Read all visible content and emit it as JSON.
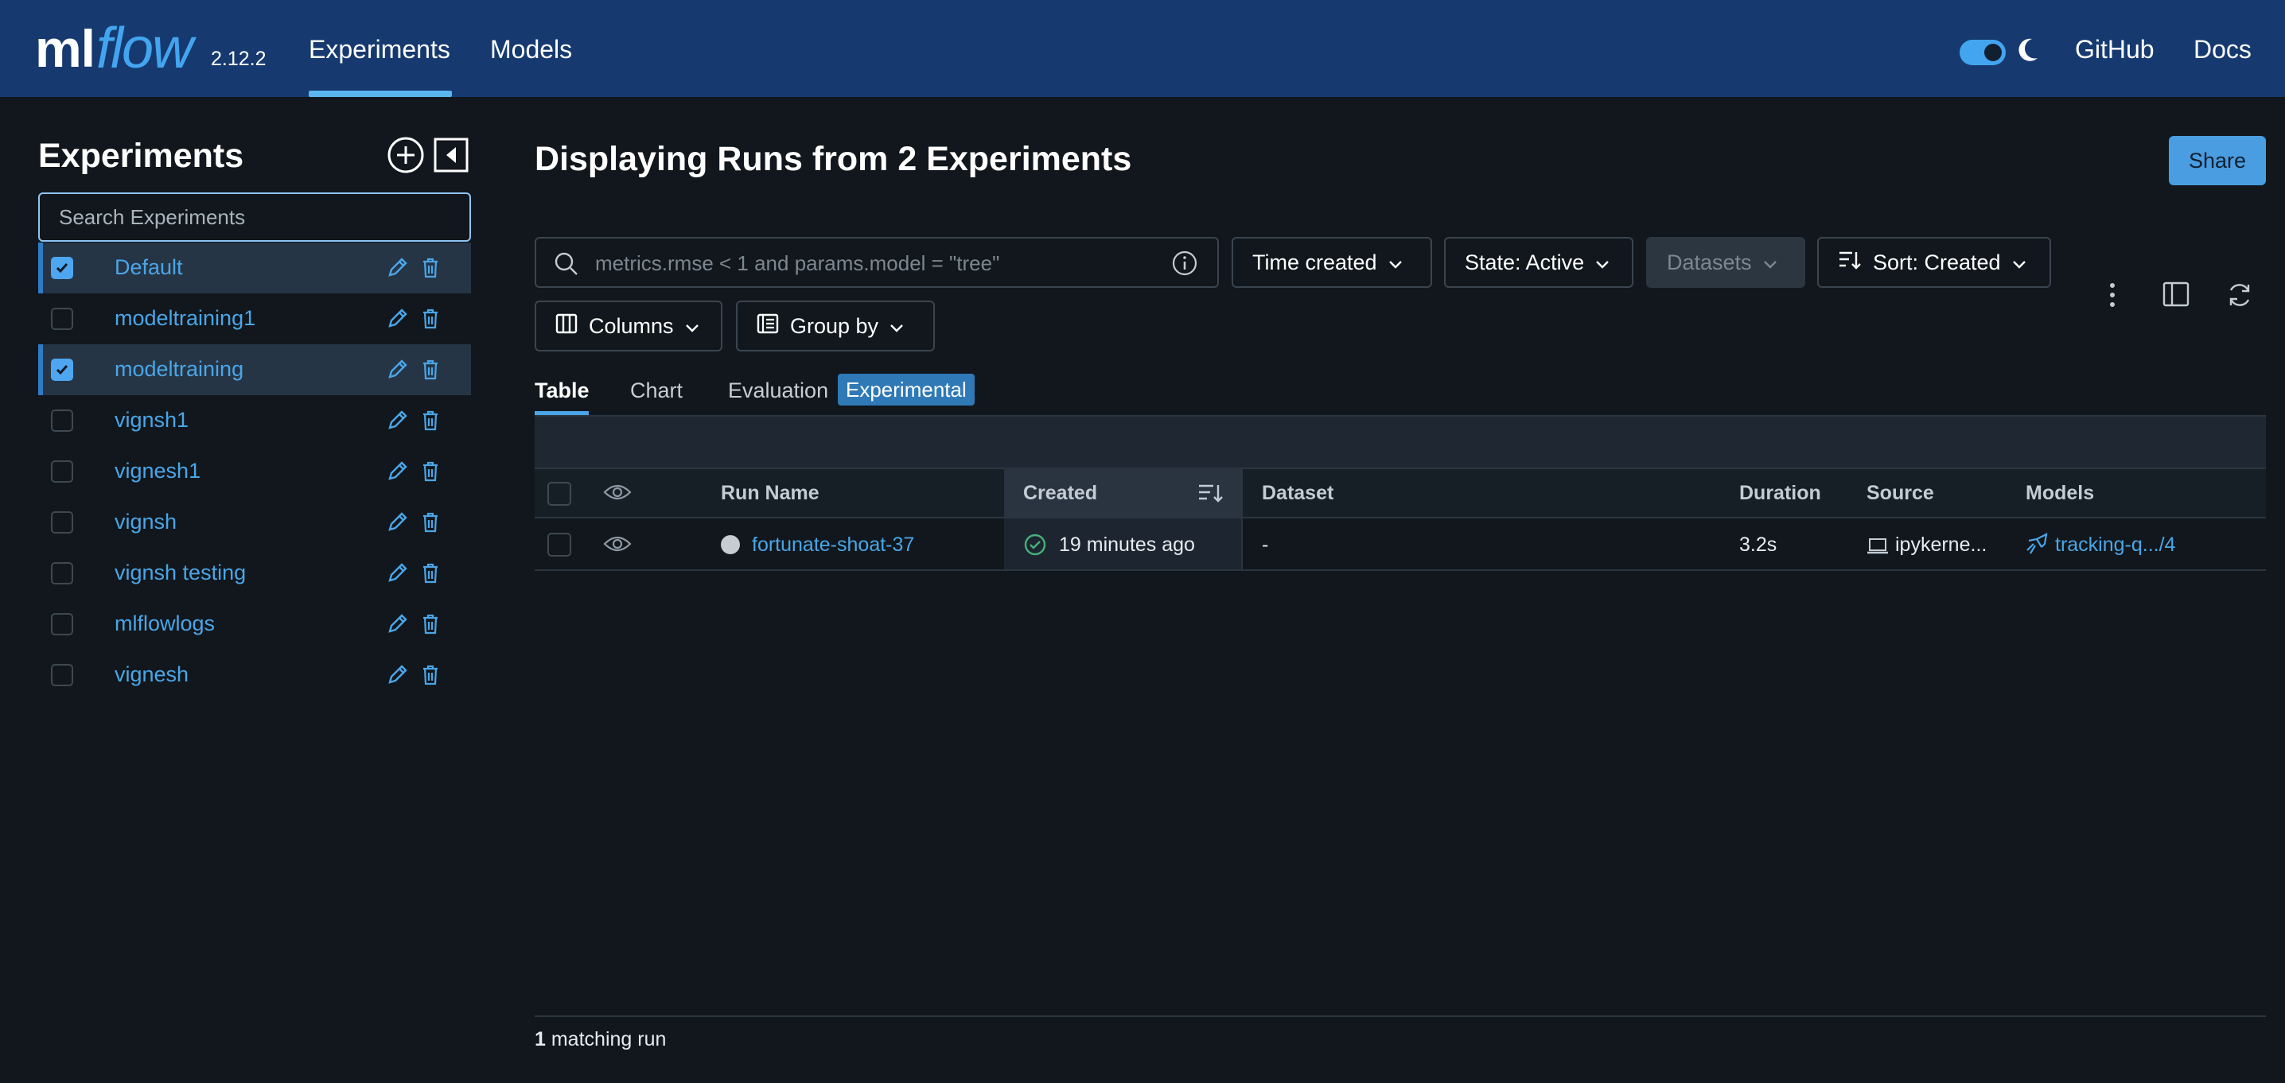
{
  "header": {
    "logo_ml": "ml",
    "logo_flow": "flow",
    "version": "2.12.2",
    "nav": [
      {
        "label": "Experiments",
        "active": true
      },
      {
        "label": "Models",
        "active": false
      }
    ],
    "github": "GitHub",
    "docs": "Docs",
    "dark_mode": true
  },
  "sidebar": {
    "title": "Experiments",
    "search_placeholder": "Search Experiments",
    "experiments": [
      {
        "name": "Default",
        "checked": true
      },
      {
        "name": "modeltraining1",
        "checked": false
      },
      {
        "name": "modeltraining",
        "checked": true
      },
      {
        "name": "vignsh1",
        "checked": false
      },
      {
        "name": "vignesh1",
        "checked": false
      },
      {
        "name": "vignsh",
        "checked": false
      },
      {
        "name": "vignsh testing",
        "checked": false
      },
      {
        "name": "mlflowlogs",
        "checked": false
      },
      {
        "name": "vignesh",
        "checked": false
      }
    ]
  },
  "main": {
    "title": "Displaying Runs from 2 Experiments",
    "share": "Share",
    "filter_placeholder": "metrics.rmse < 1 and params.model = \"tree\"",
    "time_created": "Time created",
    "state": "State: Active",
    "datasets": "Datasets",
    "sort": "Sort: Created",
    "columns": "Columns",
    "group_by": "Group by",
    "tabs": {
      "table": "Table",
      "chart": "Chart",
      "evaluation": "Evaluation",
      "experimental": "Experimental"
    },
    "table": {
      "headers": {
        "run_name": "Run Name",
        "created": "Created",
        "dataset": "Dataset",
        "duration": "Duration",
        "source": "Source",
        "models": "Models"
      },
      "rows": [
        {
          "run_name": "fortunate-shoat-37",
          "created": "19 minutes ago",
          "dataset": "-",
          "duration": "3.2s",
          "source": "ipykerne...",
          "models": "tracking-q.../4"
        }
      ]
    },
    "footer_count": "1",
    "footer_label": "matching run"
  },
  "colors": {
    "header_bg": "#163a70",
    "page_bg": "#11171c",
    "accent": "#4aa6e8",
    "selected_row": "#263545"
  }
}
